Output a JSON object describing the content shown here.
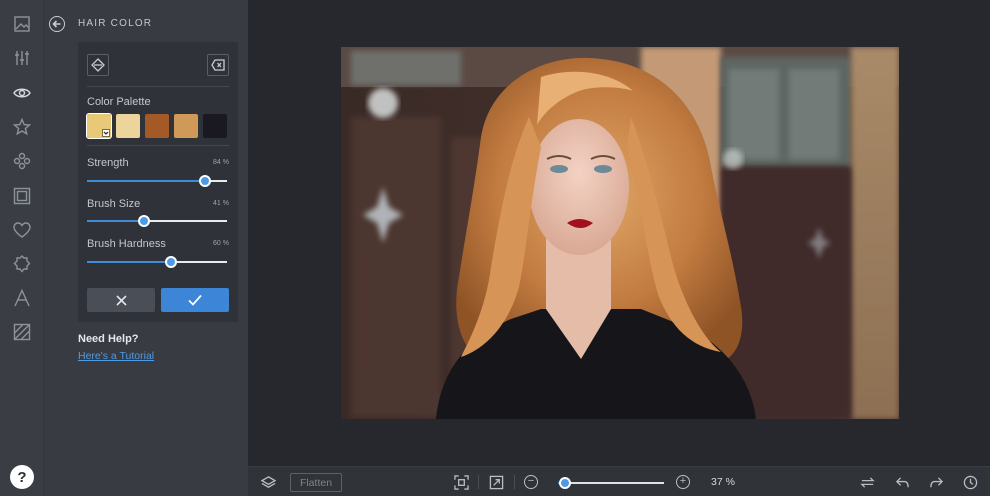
{
  "panel": {
    "title": "HAIR COLOR",
    "palette_label": "Color Palette",
    "swatches": [
      {
        "color": "#e7c978",
        "selected": true
      },
      {
        "color": "#ecd49a",
        "selected": false
      },
      {
        "color": "#a35a26",
        "selected": false
      },
      {
        "color": "#cf9a58",
        "selected": false
      },
      {
        "color": "#1a1922",
        "selected": false
      }
    ],
    "strength": {
      "label": "Strength",
      "value_text": "84 %",
      "value": 84
    },
    "brush_size": {
      "label": "Brush Size",
      "value_text": "41 %",
      "value": 41
    },
    "brush_hardness": {
      "label": "Brush Hardness",
      "value_text": "60 %",
      "value": 60
    },
    "help_heading": "Need Help?",
    "help_link": "Here's a Tutorial"
  },
  "toolbar": {
    "flatten_label": "Flatten",
    "zoom_text": "37 %",
    "zoom_value": 37
  },
  "rail": {
    "icons": [
      "image-icon",
      "sliders-icon",
      "eye-icon",
      "star-icon",
      "sparkle-icon",
      "frame-icon",
      "heart-icon",
      "badge-icon",
      "text-icon",
      "texture-icon"
    ],
    "active": "eye-icon",
    "help_label": "?"
  },
  "colors": {
    "accent": "#3d85d6",
    "link": "#4f9be6",
    "panel_bg": "#383b42",
    "card_bg": "#2f3238",
    "canvas_bg": "#26282d"
  }
}
